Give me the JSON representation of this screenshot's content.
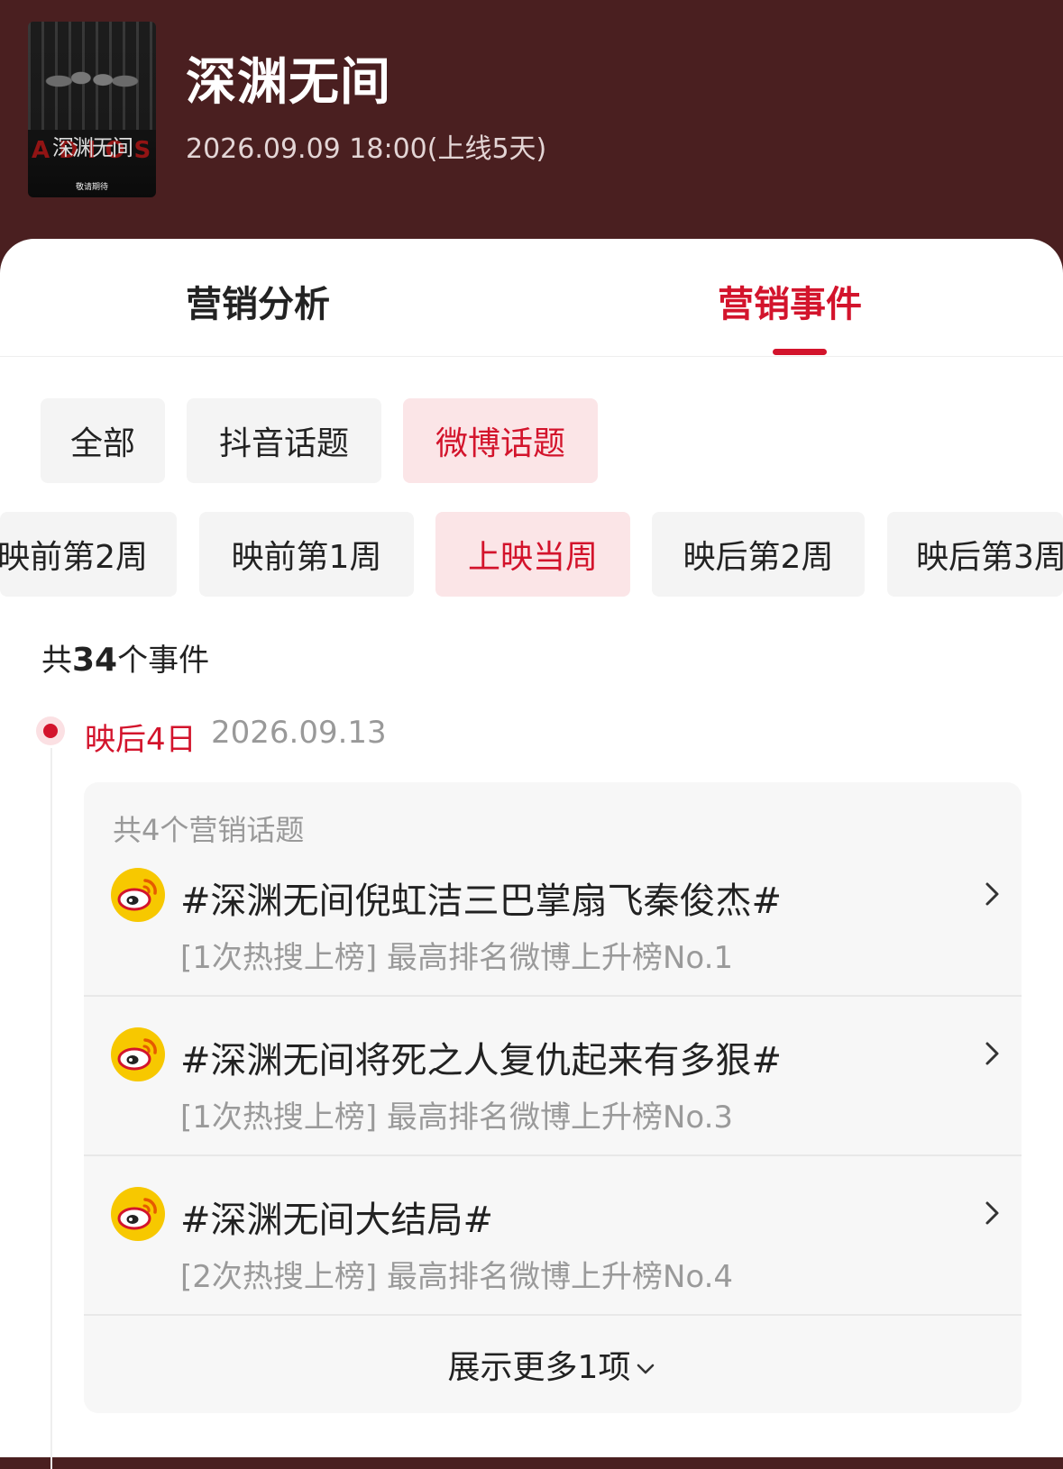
{
  "header": {
    "poster": {
      "title": "深渊无间",
      "overlay": "ADIOS",
      "note": "敬请期待"
    },
    "title": "深渊无间",
    "release": "2026.09.09 18:00(上线5天)"
  },
  "tabs": [
    {
      "label": "营销分析",
      "active": false
    },
    {
      "label": "营销事件",
      "active": true
    }
  ],
  "platform_filters": [
    {
      "label": "全部",
      "active": false
    },
    {
      "label": "抖音话题",
      "active": false
    },
    {
      "label": "微博话题",
      "active": true
    }
  ],
  "week_filters": [
    {
      "label": "映前第2周",
      "active": false
    },
    {
      "label": "映前第1周",
      "active": false
    },
    {
      "label": "上映当周",
      "active": true
    },
    {
      "label": "映后第2周",
      "active": false
    },
    {
      "label": "映后第3周",
      "active": false
    }
  ],
  "summary": {
    "prefix": "共",
    "count": "34",
    "suffix": "个事件"
  },
  "timeline": {
    "label": "映后4日",
    "date": "2026.09.13",
    "group_title": "共4个营销话题",
    "topics": [
      {
        "icon": "weibo-icon",
        "name": "#深渊无间倪虹洁三巴掌扇飞秦俊杰#",
        "desc": "[1次热搜上榜] 最高排名微博上升榜No.1"
      },
      {
        "icon": "weibo-icon",
        "name": "#深渊无间将死之人复仇起来有多狠#",
        "desc": "[1次热搜上榜] 最高排名微博上升榜No.3"
      },
      {
        "icon": "weibo-icon",
        "name": "#深渊无间大结局#",
        "desc": "[2次热搜上榜] 最高排名微博上升榜No.4"
      }
    ],
    "more_label": "展示更多1项"
  },
  "colors": {
    "header_bg": "#4a1f20",
    "accent": "#d3142c",
    "active_chip_bg": "#fbe5e7",
    "weibo_yellow": "#f7c800"
  }
}
